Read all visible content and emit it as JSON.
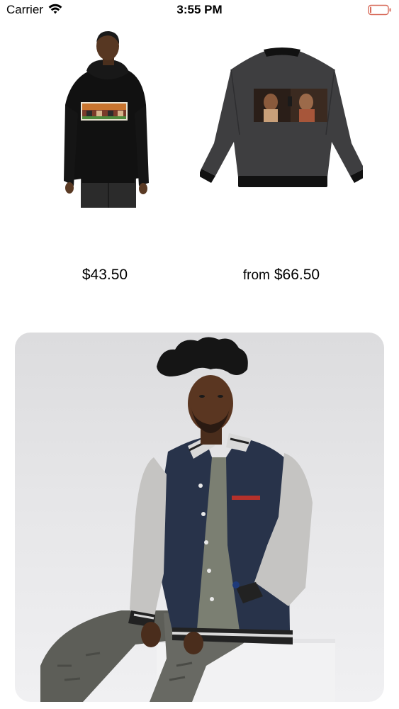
{
  "status_bar": {
    "carrier": "Carrier",
    "time": "3:55 PM",
    "icons": [
      "wifi-icon",
      "battery-icon"
    ]
  },
  "products": [
    {
      "image": "black-hoodie-photo",
      "price_prefix": "",
      "price": "$43.50"
    },
    {
      "image": "grey-bomber-jacket-photo",
      "price_prefix": "from",
      "price": "$66.50"
    }
  ],
  "feature": {
    "image": "varsity-jacket-model-photo"
  },
  "colors": {
    "battery_outline": "#d86b5a",
    "card_background": "#e4e4e6"
  }
}
